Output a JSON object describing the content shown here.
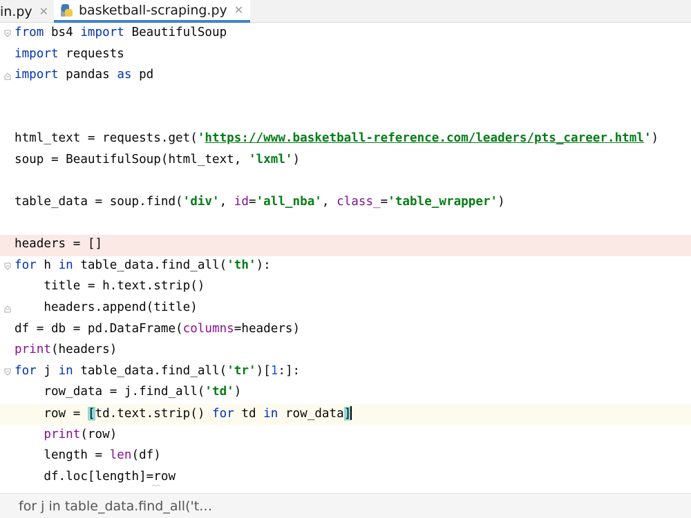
{
  "tabs": [
    {
      "label": "in.py",
      "active": false
    },
    {
      "label": "basketball-scraping.py",
      "active": true
    }
  ],
  "breadcrumb": "for j in table_data.find_all('t…",
  "colors": {
    "keyword": "#0033b3",
    "string": "#067d17",
    "keyword_arg": "#871094",
    "number": "#1750eb",
    "breakpoint_line": "#fbe9e6",
    "current_line": "#fdfbee",
    "tab_underline": "#4083c9"
  },
  "code": {
    "l1": [
      "from",
      " bs4 ",
      "import",
      " BeautifulSoup"
    ],
    "l2": [
      "import",
      " requests"
    ],
    "l3": [
      "import",
      " pandas ",
      "as",
      " pd"
    ],
    "l4": [
      "html_text = requests.get(",
      "'",
      "https://www.basketball-reference.com/leaders/pts_career.html",
      "'",
      ")"
    ],
    "l5": [
      "soup = BeautifulSoup(html_text, ",
      "'lxml'",
      ")"
    ],
    "l6": [
      "table_data = soup.find(",
      "'div'",
      ", ",
      "id",
      "=",
      "'all_nba'",
      ", ",
      "class_",
      "=",
      "'table_wrapper'",
      ")"
    ],
    "l7": [
      "headers = []"
    ],
    "l8": [
      "for",
      " h ",
      "in",
      " table_data.find_all(",
      "'th'",
      "):"
    ],
    "l9": [
      "    title = h.text.strip()"
    ],
    "l10": [
      "    headers.append(title)"
    ],
    "l11": [
      "df = db = pd.DataFrame(",
      "columns",
      "=headers)"
    ],
    "l12": [
      "print",
      "(headers)"
    ],
    "l13": [
      "for",
      " j ",
      "in",
      " table_data.find_all(",
      "'tr'",
      ")[",
      "1",
      ":]:"
    ],
    "l14": [
      "    row_data = j.find_all(",
      "'td'",
      ")"
    ],
    "l15": [
      "    row = ",
      "[",
      "td.text.strip() ",
      "for",
      " td ",
      "in",
      " row_data",
      "]"
    ],
    "l16": [
      "    ",
      "print",
      "(row)"
    ],
    "l17": [
      "    length = ",
      "len",
      "(df)"
    ],
    "l18": [
      "    df.loc[length]=row"
    ]
  }
}
